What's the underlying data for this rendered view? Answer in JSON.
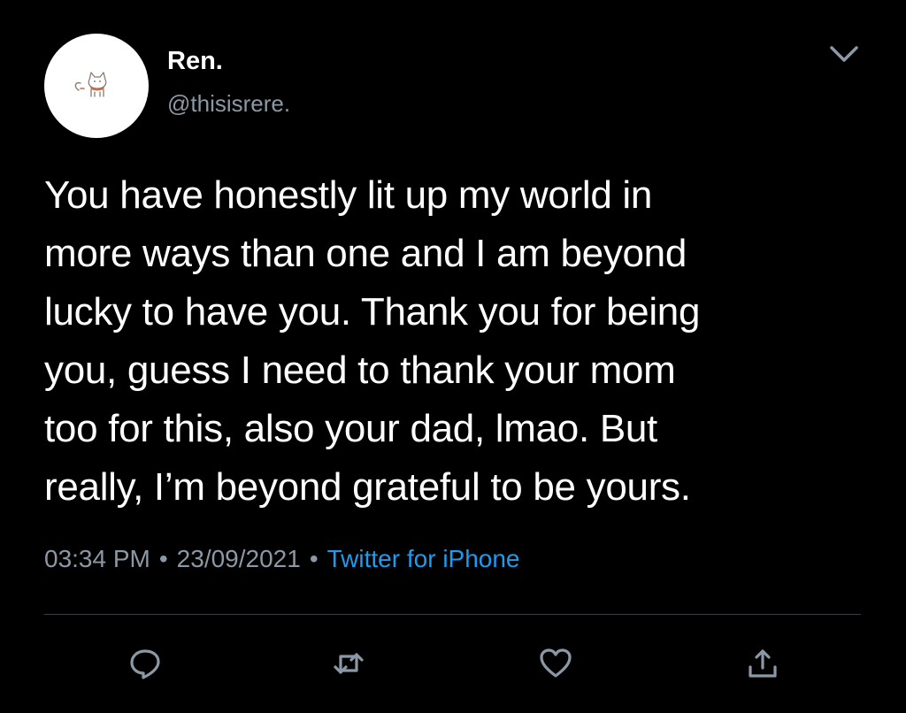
{
  "tweet": {
    "display_name": "Ren.",
    "handle": "@thisisrere.",
    "text": "You have honestly lit up my world in\nmore ways than one and I am beyond\nlucky to have you.  Thank you for being\nyou, guess I need to thank your mom\ntoo for this, also your dad, lmao.  But\nreally, I’m beyond grateful to be yours.",
    "time": "03:34 PM",
    "separator": "•",
    "date": "23/09/2021",
    "source": "Twitter for iPhone"
  },
  "icons": {
    "avatar": "cat-avatar-icon",
    "menu": "chevron-down-icon",
    "reply": "reply-icon",
    "retweet": "retweet-icon",
    "like": "heart-icon",
    "share": "share-icon"
  },
  "colors": {
    "background": "#000000",
    "text": "#ffffff",
    "muted": "#8b98a5",
    "link": "#1d9bf0",
    "divider": "#3a3f44"
  }
}
